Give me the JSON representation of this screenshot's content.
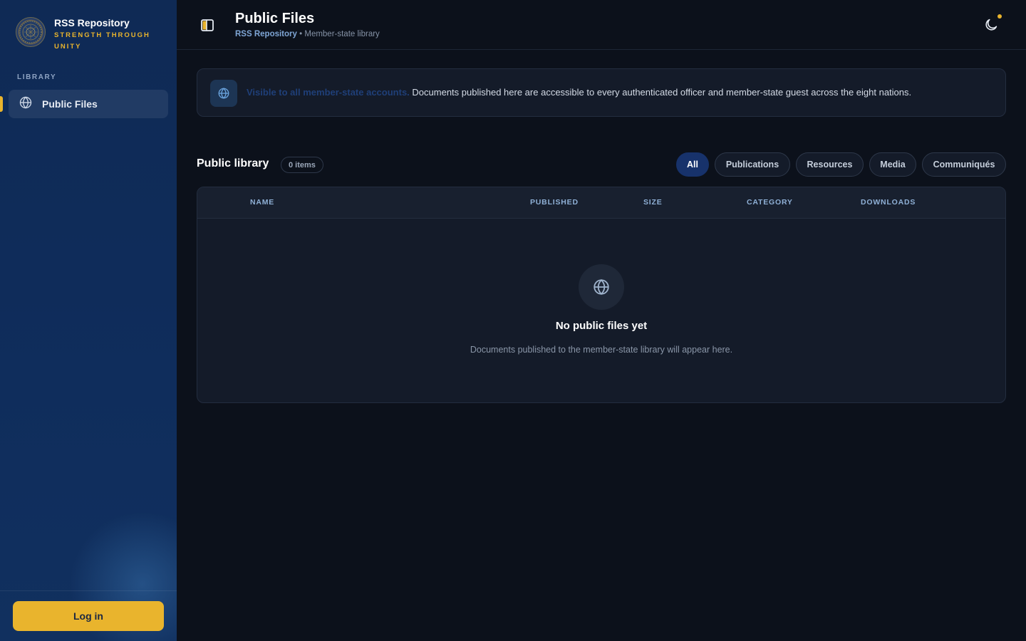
{
  "brand": {
    "title": "RSS Repository",
    "tagline": "STRENGTH THROUGH UNITY"
  },
  "sidebar": {
    "section_label": "LIBRARY",
    "items": [
      {
        "label": "Public Files",
        "icon": "globe-icon",
        "active": true
      }
    ],
    "login_label": "Log in"
  },
  "header": {
    "title": "Public Files",
    "breadcrumb_root": "RSS Repository",
    "breadcrumb_separator": "•",
    "breadcrumb_current": "Member-state library"
  },
  "notice": {
    "strong": "Visible to all member-state accounts.",
    "text": "Documents published here are accessible to every authenticated officer and member-state guest across the eight nations."
  },
  "library": {
    "title": "Public library",
    "count": "0 items",
    "filters": [
      "All",
      "Publications",
      "Resources",
      "Media",
      "Communiqués"
    ],
    "active_filter": "All"
  },
  "table": {
    "columns": [
      "NAME",
      "PUBLISHED",
      "SIZE",
      "CATEGORY",
      "DOWNLOADS"
    ],
    "rows": [],
    "empty_title": "No public files yet",
    "empty_subtitle": "Documents published to the member-state library will appear here."
  },
  "colors": {
    "accent": "#e9b42d",
    "sidebar_bg": "#0f2a55",
    "page_bg": "#0c111b",
    "active_chip": "#17326b"
  }
}
